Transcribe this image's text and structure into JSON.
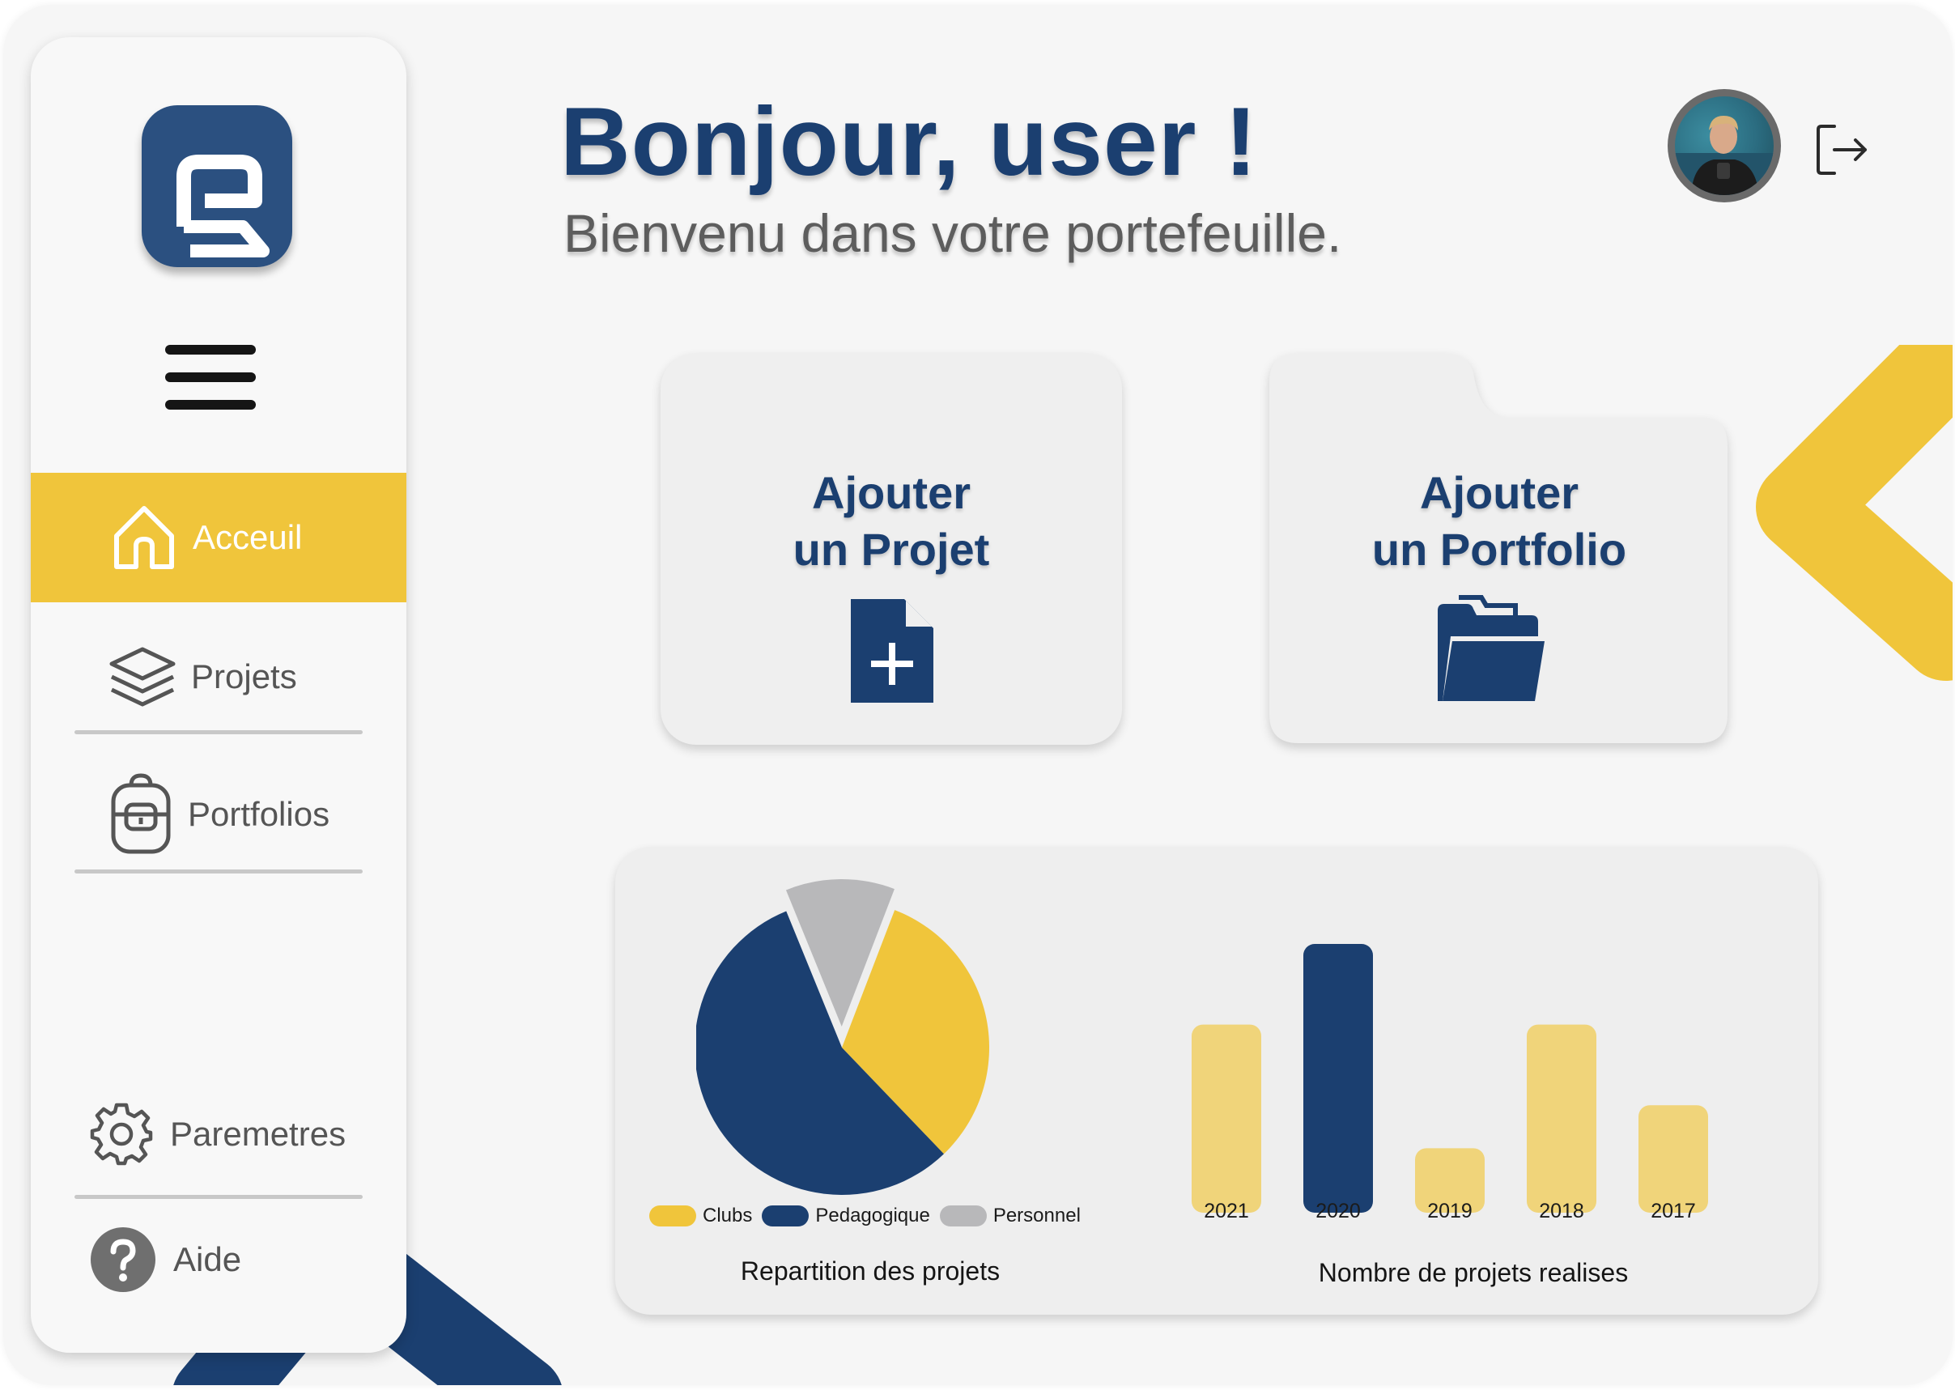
{
  "header": {
    "greeting": "Bonjour, user !",
    "subtitle": "Bienvenu dans votre portefeuille."
  },
  "sidebar": {
    "items": [
      {
        "label": "Acceuil",
        "icon": "home-icon",
        "active": true
      },
      {
        "label": "Projets",
        "icon": "layers-icon",
        "active": false
      },
      {
        "label": "Portfolios",
        "icon": "backpack-icon",
        "active": false
      }
    ],
    "bottom_items": [
      {
        "label": "Paremetres",
        "icon": "gear-icon"
      },
      {
        "label": "Aide",
        "icon": "help-icon"
      }
    ]
  },
  "cards": {
    "projet": {
      "line1": "Ajouter",
      "line2": "un Projet",
      "icon": "file-plus-icon"
    },
    "portfolio": {
      "line1": "Ajouter",
      "line2": "un Portfolio",
      "icon": "folder-open-icon"
    }
  },
  "colors": {
    "primary": "#1b3f70",
    "accent": "#f0c53b",
    "accent_light": "#f0d47a",
    "grey": "#b8b8ba"
  },
  "chart_data": [
    {
      "type": "pie",
      "caption": "Repartition des projets",
      "slices": [
        {
          "label": "Clubs",
          "value": 32,
          "color": "#f0c53b"
        },
        {
          "label": "Pedagogique",
          "value": 56,
          "color": "#1b3f70"
        },
        {
          "label": "Personnel",
          "value": 12,
          "color": "#b8b8ba",
          "exploded": true
        }
      ]
    },
    {
      "type": "bar",
      "caption": "Nombre de projets realises",
      "categories": [
        "2021",
        "2020",
        "2019",
        "2018",
        "2017"
      ],
      "values": [
        7,
        10,
        2.4,
        7,
        4
      ]
    }
  ]
}
